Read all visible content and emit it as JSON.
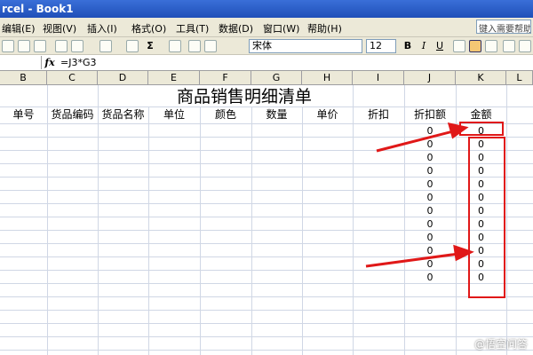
{
  "window": {
    "title": "rcel - Book1"
  },
  "menu": {
    "items": [
      "编辑(E)",
      "视图(V)",
      "插入(I)",
      "格式(O)",
      "工具(T)",
      "数据(D)",
      "窗口(W)",
      "帮助(H)"
    ],
    "help_placeholder": "键入需要帮助"
  },
  "toolbar": {
    "sum_label": "Σ",
    "font_name": "宋体",
    "font_size": "12",
    "bold": "B",
    "italic": "I",
    "underline": "U"
  },
  "formula_bar": {
    "fx": "fx",
    "formula": "=J3*G3"
  },
  "grid": {
    "columns": [
      "B",
      "C",
      "D",
      "E",
      "F",
      "G",
      "H",
      "I",
      "J",
      "K",
      "L"
    ],
    "sheet_title": "商品销售明细清单",
    "headers": [
      "单号",
      "货品编码",
      "货品名称",
      "单位",
      "颜色",
      "数量",
      "单价",
      "折扣",
      "折扣额",
      "金额"
    ],
    "discount_values": [
      "0",
      "0",
      "0",
      "0",
      "0",
      "0",
      "0",
      "0",
      "0",
      "0",
      "0",
      "0"
    ],
    "amount_values": [
      "0",
      "0",
      "0",
      "0",
      "0",
      "0",
      "0",
      "0",
      "0",
      "0",
      "0",
      "0"
    ]
  },
  "annotation": {
    "color": "#e01818"
  },
  "watermark": "@悟空问答"
}
